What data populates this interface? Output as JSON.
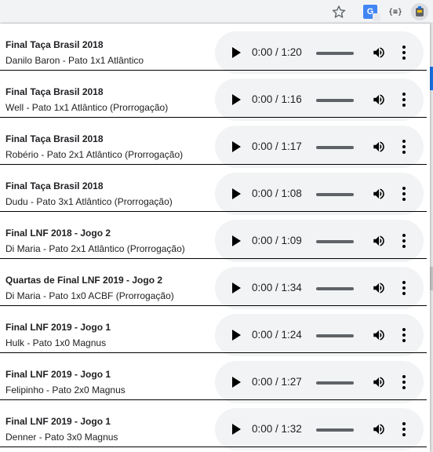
{
  "toolbar": {
    "json_label": "{≡}",
    "translate_label": "G"
  },
  "audio_items": [
    {
      "title": "Final Taça Brasil 2018",
      "subtitle": "Danilo Baron - Pato 1x1 Atlântico",
      "time": "0:00 / 1:20"
    },
    {
      "title": "Final Taça Brasil 2018",
      "subtitle": "Well - Pato 1x1 Atlântico (Prorrogação)",
      "time": "0:00 / 1:16"
    },
    {
      "title": "Final Taça Brasil 2018",
      "subtitle": "Robério - Pato 2x1 Atlântico (Prorrogação)",
      "time": "0:00 / 1:17"
    },
    {
      "title": "Final Taça Brasil 2018",
      "subtitle": "Dudu - Pato 3x1 Atlântico (Prorrogação)",
      "time": "0:00 / 1:08"
    },
    {
      "title": "Final LNF 2018 - Jogo 2",
      "subtitle": "Di Maria - Pato 2x1 Atlântico (Prorrogação)",
      "time": "0:00 / 1:09"
    },
    {
      "title": "Quartas de Final LNF 2019 - Jogo 2",
      "subtitle": "Di Maria - Pato 1x0 ACBF (Prorrogação)",
      "time": "0:00 / 1:34"
    },
    {
      "title": "Final LNF 2019 - Jogo 1",
      "subtitle": "Hulk - Pato 1x0 Magnus",
      "time": "0:00 / 1:24"
    },
    {
      "title": "Final LNF 2019 - Jogo 1",
      "subtitle": "Felipinho - Pato 2x0 Magnus",
      "time": "0:00 / 1:27"
    },
    {
      "title": "Final LNF 2019 - Jogo 1",
      "subtitle": "Denner - Pato 3x0 Magnus",
      "time": "0:00 / 1:32"
    }
  ]
}
